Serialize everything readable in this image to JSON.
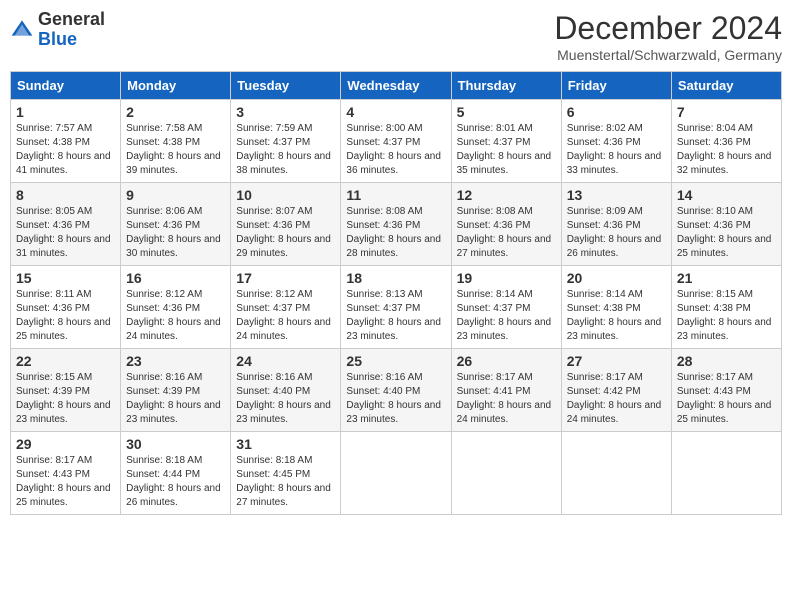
{
  "header": {
    "logo_line1": "General",
    "logo_line2": "Blue",
    "month_title": "December 2024",
    "location": "Muenstertal/Schwarzwald, Germany"
  },
  "days_of_week": [
    "Sunday",
    "Monday",
    "Tuesday",
    "Wednesday",
    "Thursday",
    "Friday",
    "Saturday"
  ],
  "weeks": [
    [
      {
        "day": "1",
        "sunrise": "7:57 AM",
        "sunset": "4:38 PM",
        "daylight": "8 hours and 41 minutes."
      },
      {
        "day": "2",
        "sunrise": "7:58 AM",
        "sunset": "4:38 PM",
        "daylight": "8 hours and 39 minutes."
      },
      {
        "day": "3",
        "sunrise": "7:59 AM",
        "sunset": "4:37 PM",
        "daylight": "8 hours and 38 minutes."
      },
      {
        "day": "4",
        "sunrise": "8:00 AM",
        "sunset": "4:37 PM",
        "daylight": "8 hours and 36 minutes."
      },
      {
        "day": "5",
        "sunrise": "8:01 AM",
        "sunset": "4:37 PM",
        "daylight": "8 hours and 35 minutes."
      },
      {
        "day": "6",
        "sunrise": "8:02 AM",
        "sunset": "4:36 PM",
        "daylight": "8 hours and 33 minutes."
      },
      {
        "day": "7",
        "sunrise": "8:04 AM",
        "sunset": "4:36 PM",
        "daylight": "8 hours and 32 minutes."
      }
    ],
    [
      {
        "day": "8",
        "sunrise": "8:05 AM",
        "sunset": "4:36 PM",
        "daylight": "8 hours and 31 minutes."
      },
      {
        "day": "9",
        "sunrise": "8:06 AM",
        "sunset": "4:36 PM",
        "daylight": "8 hours and 30 minutes."
      },
      {
        "day": "10",
        "sunrise": "8:07 AM",
        "sunset": "4:36 PM",
        "daylight": "8 hours and 29 minutes."
      },
      {
        "day": "11",
        "sunrise": "8:08 AM",
        "sunset": "4:36 PM",
        "daylight": "8 hours and 28 minutes."
      },
      {
        "day": "12",
        "sunrise": "8:08 AM",
        "sunset": "4:36 PM",
        "daylight": "8 hours and 27 minutes."
      },
      {
        "day": "13",
        "sunrise": "8:09 AM",
        "sunset": "4:36 PM",
        "daylight": "8 hours and 26 minutes."
      },
      {
        "day": "14",
        "sunrise": "8:10 AM",
        "sunset": "4:36 PM",
        "daylight": "8 hours and 25 minutes."
      }
    ],
    [
      {
        "day": "15",
        "sunrise": "8:11 AM",
        "sunset": "4:36 PM",
        "daylight": "8 hours and 25 minutes."
      },
      {
        "day": "16",
        "sunrise": "8:12 AM",
        "sunset": "4:36 PM",
        "daylight": "8 hours and 24 minutes."
      },
      {
        "day": "17",
        "sunrise": "8:12 AM",
        "sunset": "4:37 PM",
        "daylight": "8 hours and 24 minutes."
      },
      {
        "day": "18",
        "sunrise": "8:13 AM",
        "sunset": "4:37 PM",
        "daylight": "8 hours and 23 minutes."
      },
      {
        "day": "19",
        "sunrise": "8:14 AM",
        "sunset": "4:37 PM",
        "daylight": "8 hours and 23 minutes."
      },
      {
        "day": "20",
        "sunrise": "8:14 AM",
        "sunset": "4:38 PM",
        "daylight": "8 hours and 23 minutes."
      },
      {
        "day": "21",
        "sunrise": "8:15 AM",
        "sunset": "4:38 PM",
        "daylight": "8 hours and 23 minutes."
      }
    ],
    [
      {
        "day": "22",
        "sunrise": "8:15 AM",
        "sunset": "4:39 PM",
        "daylight": "8 hours and 23 minutes."
      },
      {
        "day": "23",
        "sunrise": "8:16 AM",
        "sunset": "4:39 PM",
        "daylight": "8 hours and 23 minutes."
      },
      {
        "day": "24",
        "sunrise": "8:16 AM",
        "sunset": "4:40 PM",
        "daylight": "8 hours and 23 minutes."
      },
      {
        "day": "25",
        "sunrise": "8:16 AM",
        "sunset": "4:40 PM",
        "daylight": "8 hours and 23 minutes."
      },
      {
        "day": "26",
        "sunrise": "8:17 AM",
        "sunset": "4:41 PM",
        "daylight": "8 hours and 24 minutes."
      },
      {
        "day": "27",
        "sunrise": "8:17 AM",
        "sunset": "4:42 PM",
        "daylight": "8 hours and 24 minutes."
      },
      {
        "day": "28",
        "sunrise": "8:17 AM",
        "sunset": "4:43 PM",
        "daylight": "8 hours and 25 minutes."
      }
    ],
    [
      {
        "day": "29",
        "sunrise": "8:17 AM",
        "sunset": "4:43 PM",
        "daylight": "8 hours and 25 minutes."
      },
      {
        "day": "30",
        "sunrise": "8:18 AM",
        "sunset": "4:44 PM",
        "daylight": "8 hours and 26 minutes."
      },
      {
        "day": "31",
        "sunrise": "8:18 AM",
        "sunset": "4:45 PM",
        "daylight": "8 hours and 27 minutes."
      },
      null,
      null,
      null,
      null
    ]
  ]
}
